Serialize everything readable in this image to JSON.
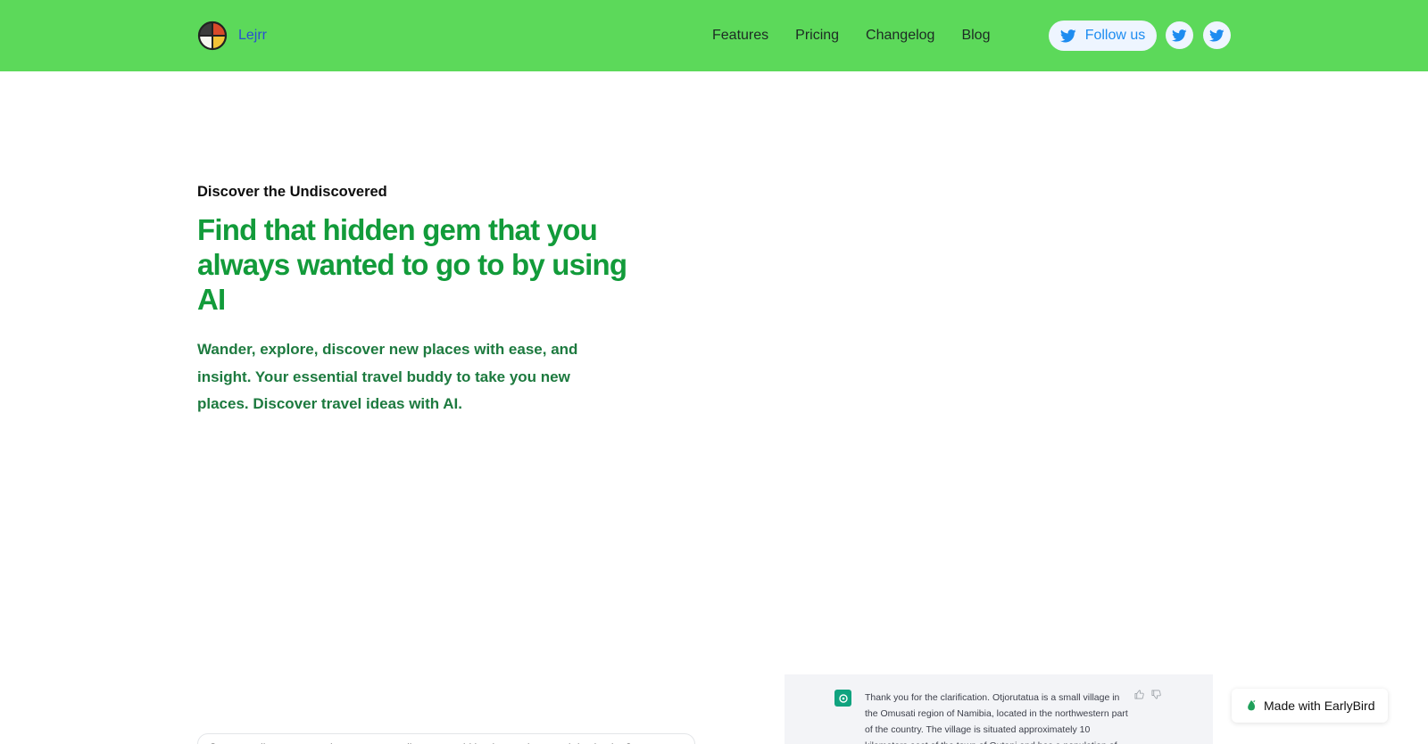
{
  "header": {
    "brand_name": "Lejrr",
    "nav": [
      "Features",
      "Pricing",
      "Changelog",
      "Blog"
    ],
    "follow_label": "Follow us",
    "social_icons": [
      "twitter-icon",
      "twitter-icon"
    ]
  },
  "hero": {
    "eyebrow": "Discover the Undiscovered",
    "headline": "Find that hidden gem that you always wanted to go to by using AI",
    "subtext": "Wander, explore, discover new places with ease, and insight. Your essential travel buddy to take you new places. Discover travel ideas with AI."
  },
  "chat_preview": {
    "message": "Thank you for the clarification. Otjorutatua is a small village in the Omusati region of Namibia, located in the northwestern part of the country. The village is situated approximately 10 kilometers east of the town of Outapi and has a population of"
  },
  "search": {
    "value": "Can you tell me a secret, in-country sounding, or an old but interesting travel destination?"
  },
  "badge": {
    "label": "Made with EarlyBird"
  },
  "colors": {
    "navbar_bg": "#5cd95a",
    "headline": "#129b3a",
    "subtext": "#1d7a3f",
    "twitter_blue": "#1d8cf0"
  }
}
